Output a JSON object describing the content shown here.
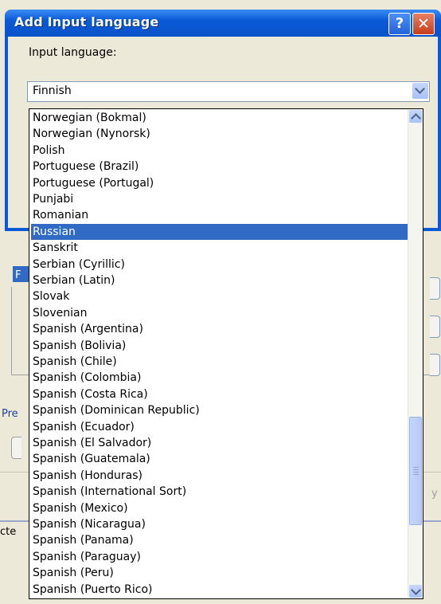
{
  "background": {
    "sel_letter": "F",
    "pre_text": "Pre",
    "cte_text": "cte",
    "y_text": "y"
  },
  "dialog": {
    "title": "Add Input language",
    "help_glyph": "?",
    "close_glyph": "✕",
    "input_language_label": "Input language:",
    "combo_value": "Finnish"
  },
  "dropdown": {
    "selected_item": "Russian",
    "items": [
      "Norwegian (Bokmal)",
      "Norwegian (Nynorsk)",
      "Polish",
      "Portuguese (Brazil)",
      "Portuguese (Portugal)",
      "Punjabi",
      "Romanian",
      "Russian",
      "Sanskrit",
      "Serbian (Cyrillic)",
      "Serbian (Latin)",
      "Slovak",
      "Slovenian",
      "Spanish (Argentina)",
      "Spanish (Bolivia)",
      "Spanish (Chile)",
      "Spanish (Colombia)",
      "Spanish (Costa Rica)",
      "Spanish (Dominican Republic)",
      "Spanish (Ecuador)",
      "Spanish (El Salvador)",
      "Spanish (Guatemala)",
      "Spanish (Honduras)",
      "Spanish (International Sort)",
      "Spanish (Mexico)",
      "Spanish (Nicaragua)",
      "Spanish (Panama)",
      "Spanish (Paraguay)",
      "Spanish (Peru)",
      "Spanish (Puerto Rico)"
    ]
  },
  "colors": {
    "selection": "#316ac5",
    "titlebar": "#0a5ad8",
    "face": "#ece9d8"
  }
}
